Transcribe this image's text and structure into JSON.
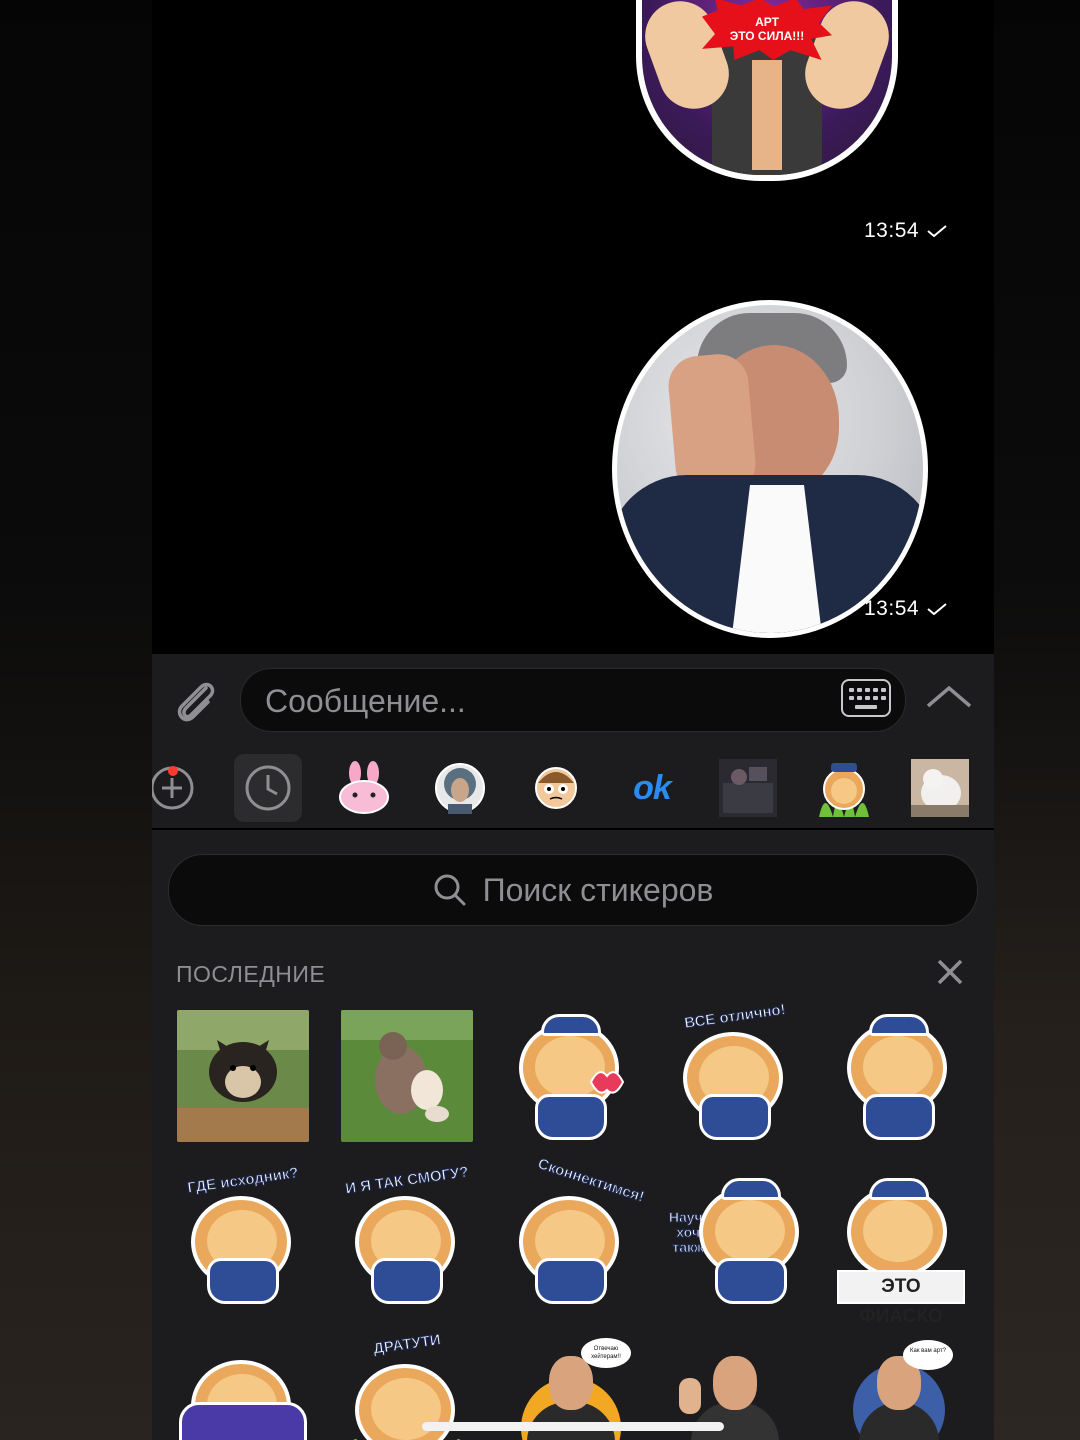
{
  "chat": {
    "sticker_art_text_line1": "АРТ",
    "sticker_art_text_line2": "ЭТО СИЛА!!!",
    "messages": [
      {
        "time": "13:54"
      },
      {
        "time": "13:54"
      }
    ]
  },
  "input": {
    "placeholder": "Сообщение..."
  },
  "sticker_tabs": [
    {
      "icon": "add-icon"
    },
    {
      "icon": "clock-icon"
    },
    {
      "icon": "bunny-sticker-pack"
    },
    {
      "icon": "astronaut-sticker-pack"
    },
    {
      "icon": "morty-sticker-pack"
    },
    {
      "icon": "ok-sticker-pack",
      "label": "ok"
    },
    {
      "icon": "photo-sticker-pack"
    },
    {
      "icon": "lion-sticker-pack"
    },
    {
      "icon": "cat-sticker-pack"
    }
  ],
  "panel": {
    "search_placeholder": "Поиск стикеров",
    "section_title": "ПОСЛЕДНИЕ"
  },
  "stickers": {
    "row1": [
      "",
      "",
      "",
      "ВСЕ отлично!",
      ""
    ],
    "row2": [
      "ГДЕ исходник?",
      "И Я ТАК СМОГУ?",
      "Сконнектимся!",
      "Научи, хочу также",
      "ЭТО ФИАСКО"
    ],
    "row3": [
      "",
      "ДРАТУТИ",
      "Отвечаю хейтерам!!",
      "",
      "Как вам арт?"
    ]
  },
  "colors": {
    "accent": "#2a8bf2",
    "panel_bg": "#1c1c1e",
    "badge_red": "#ff3b30"
  }
}
